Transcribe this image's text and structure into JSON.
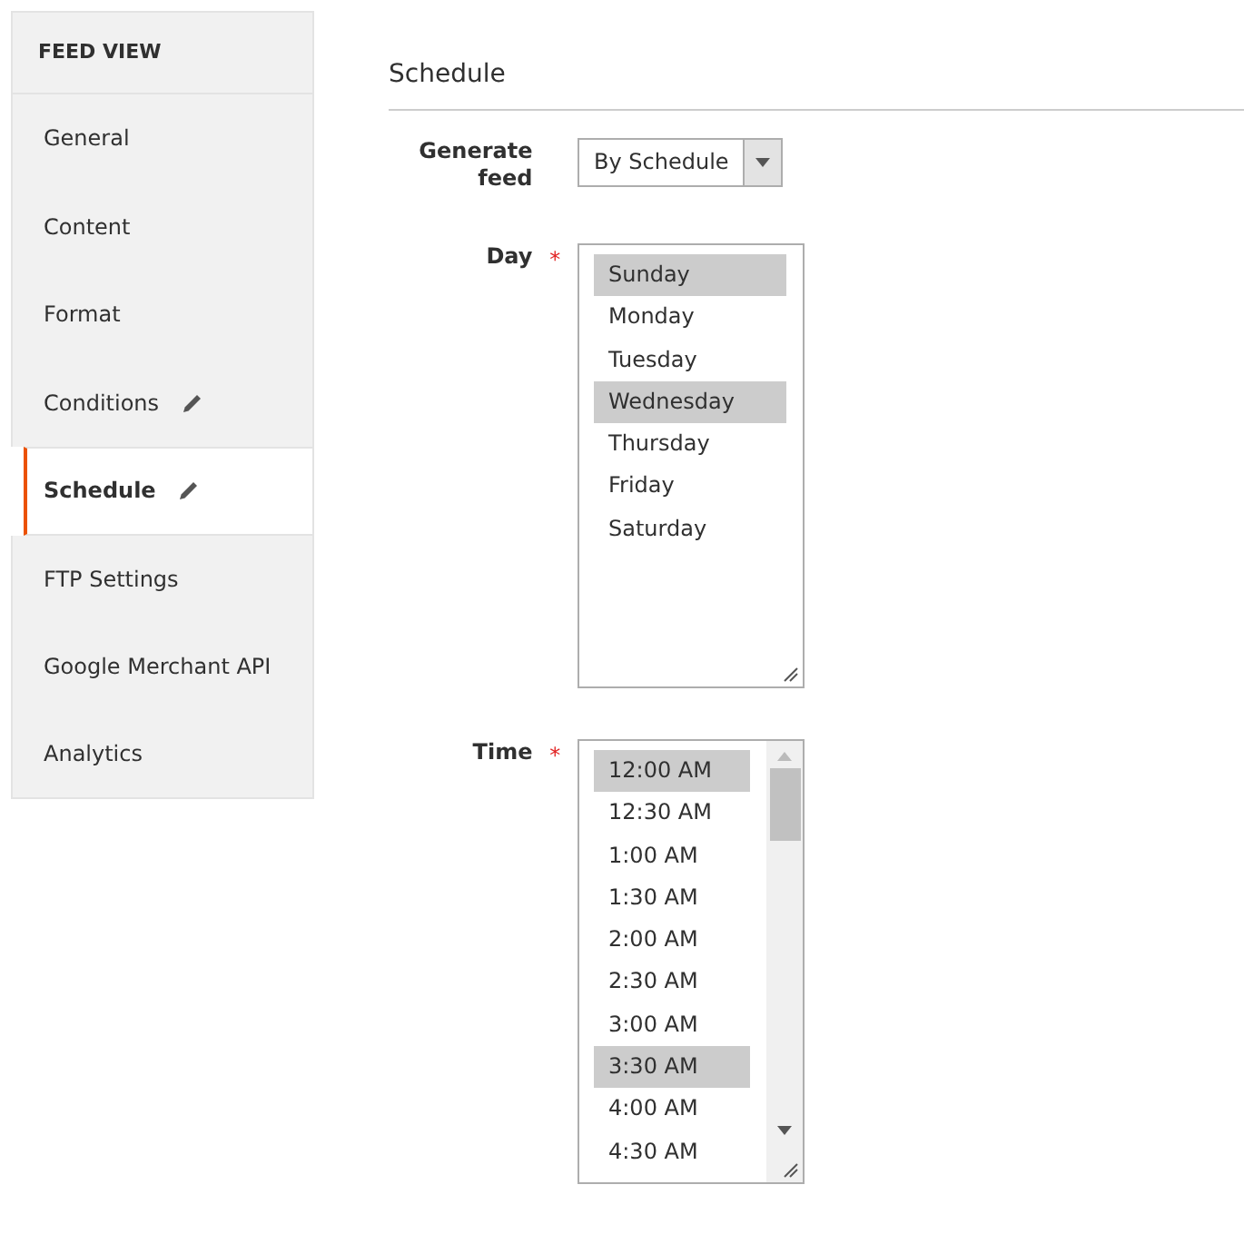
{
  "sidebar": {
    "title": "FEED VIEW",
    "items": [
      {
        "label": "General",
        "selected": false,
        "edited": false
      },
      {
        "label": "Content",
        "selected": false,
        "edited": false
      },
      {
        "label": "Format",
        "selected": false,
        "edited": false
      },
      {
        "label": "Conditions",
        "selected": false,
        "edited": true
      },
      {
        "label": "Schedule",
        "selected": true,
        "edited": true
      },
      {
        "label": "FTP Settings",
        "selected": false,
        "edited": false
      },
      {
        "label": "Google Merchant API",
        "selected": false,
        "edited": false
      },
      {
        "label": "Analytics",
        "selected": false,
        "edited": false
      }
    ]
  },
  "section": {
    "title": "Schedule",
    "fields": [
      {
        "kind": "select",
        "label": "Generate feed",
        "value": "By Schedule"
      },
      {
        "kind": "multiselect",
        "label": "Day",
        "required_mark": "*",
        "scrollbar": false,
        "options": [
          {
            "label": "Sunday",
            "selected": true
          },
          {
            "label": "Monday",
            "selected": false
          },
          {
            "label": "Tuesday",
            "selected": false
          },
          {
            "label": "Wednesday",
            "selected": true
          },
          {
            "label": "Thursday",
            "selected": false
          },
          {
            "label": "Friday",
            "selected": false
          },
          {
            "label": "Saturday",
            "selected": false
          }
        ]
      },
      {
        "kind": "multiselect",
        "label": "Time",
        "required_mark": "*",
        "scrollbar": true,
        "options": [
          {
            "label": "12:00 AM",
            "selected": true
          },
          {
            "label": "12:30 AM",
            "selected": false
          },
          {
            "label": "1:00 AM",
            "selected": false
          },
          {
            "label": "1:30 AM",
            "selected": false
          },
          {
            "label": "2:00 AM",
            "selected": false
          },
          {
            "label": "2:30 AM",
            "selected": false
          },
          {
            "label": "3:00 AM",
            "selected": false
          },
          {
            "label": "3:30 AM",
            "selected": true
          },
          {
            "label": "4:00 AM",
            "selected": false
          },
          {
            "label": "4:30 AM",
            "selected": false
          }
        ]
      }
    ]
  }
}
